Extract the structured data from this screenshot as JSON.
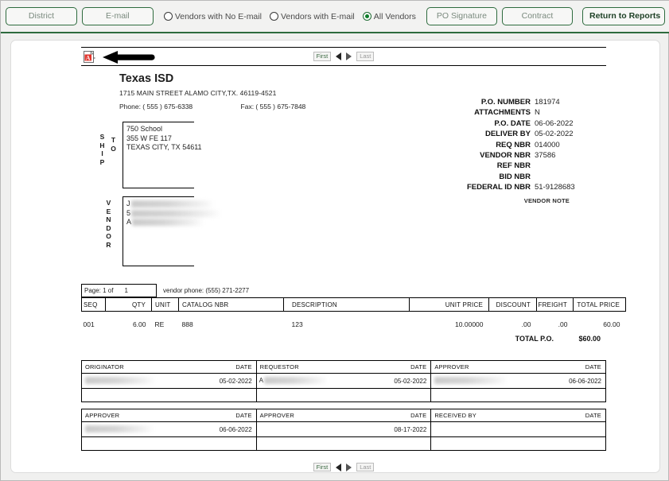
{
  "toolbar": {
    "buttons": [
      {
        "label": "District",
        "name": "district-button",
        "active": false
      },
      {
        "label": "E-mail",
        "name": "email-button",
        "active": false
      },
      {
        "label": "PO Signature",
        "name": "po-signature-button",
        "active": false
      },
      {
        "label": "Contract",
        "name": "contract-button",
        "active": false
      },
      {
        "label": "Return to Reports",
        "name": "return-to-reports-button",
        "active": true
      }
    ],
    "district_label": "District",
    "email_label": "E-mail",
    "po_signature_label": "PO Signature",
    "contract_label": "Contract",
    "return_label": "Return to Reports",
    "radios": [
      {
        "label": "Vendors with No E-mail",
        "selected": false
      },
      {
        "label": "Vendors with E-mail",
        "selected": false
      },
      {
        "label": "All Vendors",
        "selected": true
      }
    ],
    "radio_no_email": "Vendors with No E-mail",
    "radio_with_email": "Vendors with E-mail",
    "radio_all": "All Vendors",
    "accent_color": "#2e6b3e"
  },
  "pager": {
    "first_label": "First",
    "last_label": "Last",
    "prev_icon": "triangle-left-icon",
    "next_icon": "triangle-right-icon",
    "export_icon": "pdf-icon"
  },
  "report": {
    "org_name": "Texas ISD",
    "org_address": "1715 MAIN STREET ALAMO CITY,TX. 46119-4521",
    "phone": "Phone: ( 555 ) 675-6338",
    "fax": "Fax: ( 555 ) 675-7848",
    "po_meta": [
      {
        "key": "P.O. NUMBER",
        "value": "181974"
      },
      {
        "key": "ATTACHMENTS",
        "value": "N"
      },
      {
        "key": "P.O. DATE",
        "value": "06-06-2022"
      },
      {
        "key": "DELIVER BY",
        "value": "05-02-2022"
      },
      {
        "key": "REQ NBR",
        "value": "014000"
      },
      {
        "key": "VENDOR NBR",
        "value": "37586"
      },
      {
        "key": "REF NBR",
        "value": ""
      },
      {
        "key": "BID NBR",
        "value": ""
      },
      {
        "key": "FEDERAL ID NBR",
        "value": "51-9128683"
      }
    ],
    "vendor_note_label": "VENDOR NOTE",
    "ship_to": {
      "label_left": "SHIP",
      "label_right": "TO",
      "lines": [
        "750 School",
        "355 W FE 117",
        "TEXAS CITY, TX 54611"
      ]
    },
    "vendor": {
      "label": "VENDOR",
      "lines": [
        "J",
        "5",
        "A"
      ],
      "redacted": true
    },
    "page_label": "Page: 1 of",
    "page_total": "1",
    "vendor_phone": "vendor phone: (555) 271-2277",
    "columns": [
      "SEQ",
      "QTY",
      "UNIT",
      "CATALOG NBR",
      "DESCRIPTION",
      "UNIT PRICE",
      "DISCOUNT",
      "FREIGHT",
      "TOTAL PRICE"
    ],
    "rows": [
      {
        "seq": "001",
        "qty": "6.00",
        "unit": "RE",
        "catalog": "888",
        "description": "123",
        "unit_price": "10.00000",
        "discount": ".00",
        "freight": ".00",
        "total_price": "60.00"
      }
    ],
    "total_label": "TOTAL P.O.",
    "total_value": "$60.00",
    "sig_table_1": [
      {
        "header": "ORIGINATOR",
        "date_header": "DATE",
        "name": "",
        "date": "05-02-2022",
        "redacted": true
      },
      {
        "header": "REQUESTOR",
        "date_header": "DATE",
        "name": "A",
        "date": "05-02-2022",
        "redacted": true
      },
      {
        "header": "APPROVER",
        "date_header": "DATE",
        "name": "",
        "date": "06-06-2022",
        "redacted": true
      }
    ],
    "sig_table_2": [
      {
        "header": "APPROVER",
        "date_header": "DATE",
        "name": "",
        "date": "06-06-2022",
        "redacted": true
      },
      {
        "header": "APPROVER",
        "date_header": "DATE",
        "name": "",
        "date": "08-17-2022",
        "redacted": false
      },
      {
        "header": "RECEIVED BY",
        "date_header": "DATE",
        "name": "",
        "date": "",
        "redacted": false
      }
    ]
  }
}
